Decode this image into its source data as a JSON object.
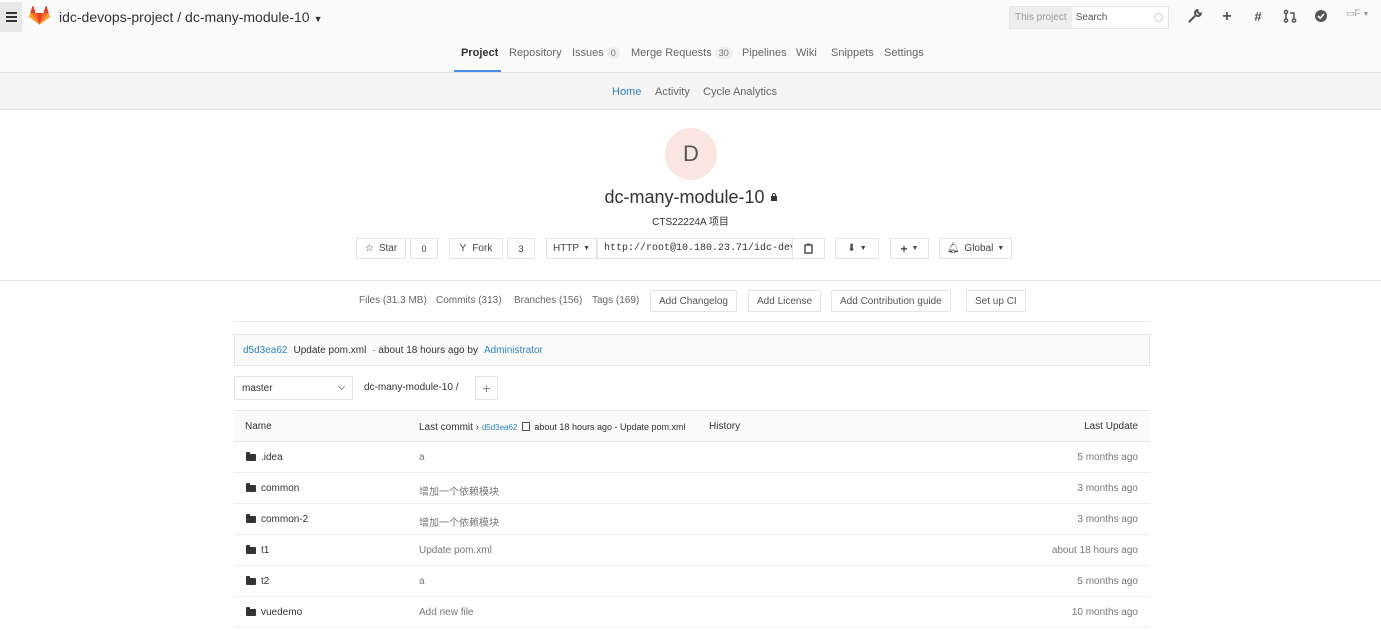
{
  "header": {
    "project_path": "idc-devops-project / dc-many-module-10",
    "search_scope": "This project",
    "search_placeholder": "Search",
    "avatar_alt": "F"
  },
  "project_nav": {
    "items": [
      {
        "label": "Project",
        "active": true
      },
      {
        "label": "Repository"
      },
      {
        "label": "Issues",
        "badge": "0"
      },
      {
        "label": "Merge Requests",
        "badge": "30"
      },
      {
        "label": "Pipelines"
      },
      {
        "label": "Wiki"
      },
      {
        "label": "Snippets"
      },
      {
        "label": "Settings"
      }
    ]
  },
  "sub_nav": {
    "items": [
      {
        "label": "Home",
        "active": true
      },
      {
        "label": "Activity"
      },
      {
        "label": "Cycle Analytics"
      }
    ]
  },
  "project": {
    "avatar_letter": "D",
    "name": "dc-many-module-10",
    "description": "CTS22224A 项目",
    "star_label": "Star",
    "star_count": "0",
    "fork_label": "Fork",
    "fork_count": "3",
    "protocol": "HTTP",
    "clone_url": "http://root@10.180.23.71/idc-dev",
    "notification": "Global"
  },
  "stats": {
    "files": "Files (31.3 MB)",
    "commits": "Commits (313)",
    "branches": "Branches (156)",
    "tags": "Tags (169)",
    "add_changelog": "Add Changelog",
    "add_license": "Add License",
    "add_contribution": "Add Contribution guide",
    "setup_ci": "Set up CI"
  },
  "last_commit": {
    "sha": "d5d3ea62",
    "message": "Update pom.xml",
    "time": "· about 18 hours ago by",
    "author": "Administrator"
  },
  "branch": {
    "name": "master",
    "path": "dc-many-module-10  /"
  },
  "table": {
    "col_name": "Name",
    "col_last_commit": "Last commit",
    "header_sha": "d5d3ea62",
    "header_commit_info": "about 18 hours ago - Update pom.xml",
    "history": "History",
    "col_last_update": "Last Update",
    "rows": [
      {
        "name": ".idea",
        "message": "a",
        "updated": "5 months ago"
      },
      {
        "name": "common",
        "message": "增加一个依赖模块",
        "updated": "3 months ago"
      },
      {
        "name": "common-2",
        "message": "增加一个依赖模块",
        "updated": "3 months ago"
      },
      {
        "name": "t1",
        "message": "Update pom.xml",
        "updated": "about 18 hours ago"
      },
      {
        "name": "t2",
        "message": "a",
        "updated": "5 months ago"
      },
      {
        "name": "vuedemo",
        "message": "Add new file",
        "updated": "10 months ago"
      }
    ]
  }
}
